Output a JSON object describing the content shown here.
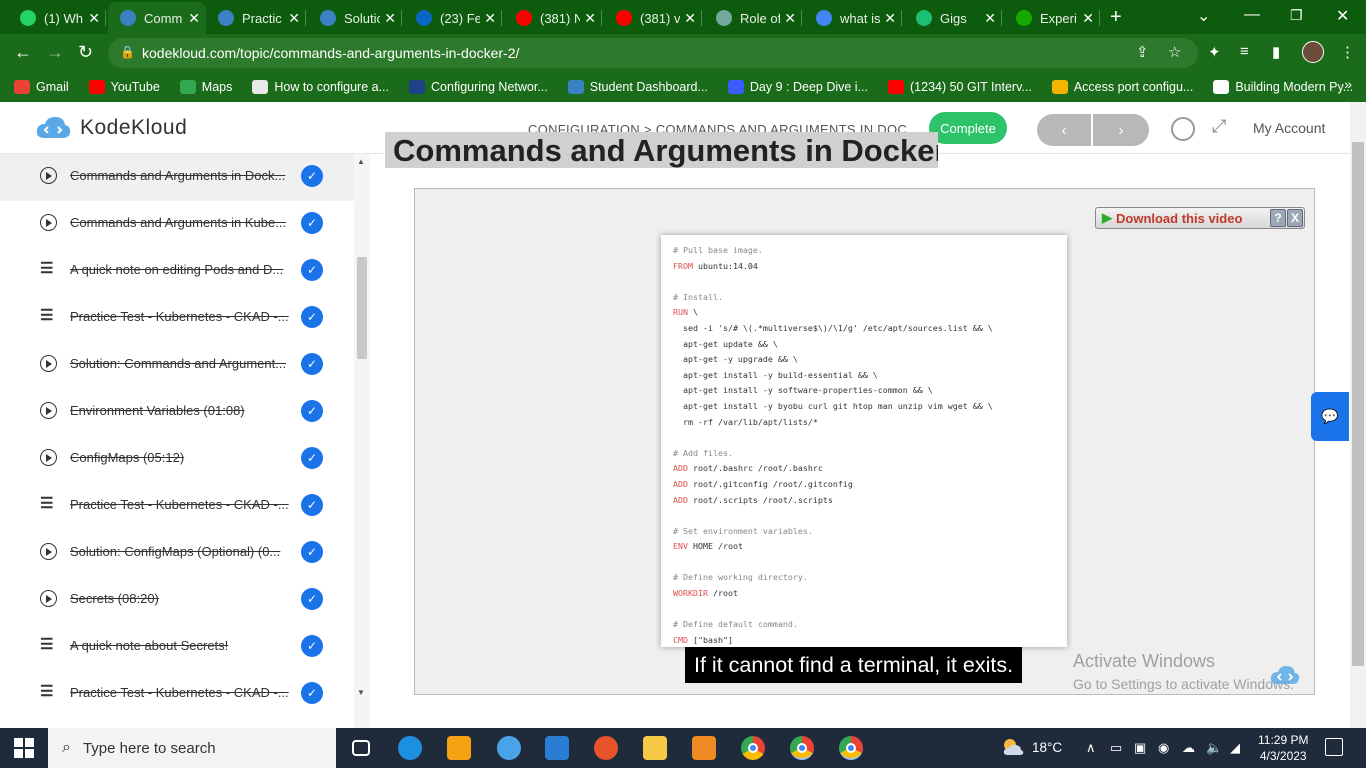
{
  "browser": {
    "tabs": [
      {
        "title": "(1) Wh",
        "icon": "whatsapp",
        "color": "#25d366",
        "active": false
      },
      {
        "title": "Comm",
        "icon": "kodekloud",
        "color": "#3b82c4",
        "active": true
      },
      {
        "title": "Practic",
        "icon": "kodekloud",
        "color": "#3b82c4",
        "active": false
      },
      {
        "title": "Solutic",
        "icon": "kodekloud",
        "color": "#3b82c4",
        "active": false
      },
      {
        "title": "(23) Fe",
        "icon": "linkedin",
        "color": "#0a66c2",
        "active": false
      },
      {
        "title": "(381) N",
        "icon": "youtube",
        "color": "#ff0000",
        "active": false
      },
      {
        "title": "(381) v",
        "icon": "youtube",
        "color": "#ff0000",
        "active": false
      },
      {
        "title": "Role of",
        "icon": "openai",
        "color": "#74aa9c",
        "active": false
      },
      {
        "title": "what is",
        "icon": "google",
        "color": "#4285f4",
        "active": false
      },
      {
        "title": "Gigs",
        "icon": "fiverr",
        "color": "#1dbf73",
        "active": false
      },
      {
        "title": "Experi",
        "icon": "upwork",
        "color": "#14a800",
        "active": false
      }
    ],
    "url": "kodekloud.com/topic/commands-and-arguments-in-docker-2/",
    "bookmarks": [
      {
        "label": "Gmail",
        "icon": "gmail",
        "color": "#ea4335"
      },
      {
        "label": "YouTube",
        "icon": "youtube",
        "color": "#ff0000"
      },
      {
        "label": "Maps",
        "icon": "maps",
        "color": "#34a853"
      },
      {
        "label": "How to configure a...",
        "icon": "page",
        "color": "#e8e8e8"
      },
      {
        "label": "Configuring Networ...",
        "icon": "vmware",
        "color": "#1d428a"
      },
      {
        "label": "Student Dashboard...",
        "icon": "kodekloud",
        "color": "#3b82c4"
      },
      {
        "label": "Day 9 : Deep Dive i...",
        "icon": "diamond",
        "color": "#3b5bfd"
      },
      {
        "label": "(1234) 50 GIT Interv...",
        "icon": "youtube",
        "color": "#ff0000"
      },
      {
        "label": "Access port configu...",
        "icon": "network",
        "color": "#f4b400"
      },
      {
        "label": "Building Modern Py...",
        "icon": "coursera",
        "color": "#ffffff"
      }
    ]
  },
  "header": {
    "logo_text": "KodeKloud",
    "breadcrumb": "CONFIGURATION > COMMANDS AND ARGUMENTS IN DOC...",
    "complete_label": "Complete",
    "prev_label": "‹",
    "next_label": "›",
    "account_label": "My Account"
  },
  "sidebar": {
    "lessons": [
      {
        "title": "Commands and Arguments in Dock...",
        "type": "video",
        "done": true,
        "active": true
      },
      {
        "title": "Commands and Arguments in Kube...",
        "type": "video",
        "done": true,
        "active": false
      },
      {
        "title": "A quick note on editing Pods and D...",
        "type": "text",
        "done": true,
        "active": false
      },
      {
        "title": "Practice Test - Kubernetes - CKAD -...",
        "type": "text",
        "done": true,
        "active": false
      },
      {
        "title": "Solution: Commands and Argument...",
        "type": "video",
        "done": true,
        "active": false
      },
      {
        "title": "Environment Variables (01:08)",
        "type": "video",
        "done": true,
        "active": false
      },
      {
        "title": "ConfigMaps (05:12)",
        "type": "video",
        "done": true,
        "active": false
      },
      {
        "title": "Practice Test - Kubernetes - CKAD -...",
        "type": "text",
        "done": true,
        "active": false
      },
      {
        "title": "Solution: ConfigMaps (Optional) (0...",
        "type": "video",
        "done": true,
        "active": false
      },
      {
        "title": "Secrets (08:20)",
        "type": "video",
        "done": true,
        "active": false
      },
      {
        "title": "A quick note about Secrets!",
        "type": "text",
        "done": true,
        "active": false
      },
      {
        "title": "Practice Test - Kubernetes - CKAD -...",
        "type": "text",
        "done": true,
        "active": false
      }
    ]
  },
  "main": {
    "page_title": "Commands and Arguments in Docker",
    "download_label": "Download this video",
    "help_label": "?",
    "close_label": "X",
    "code_lines": [
      {
        "text": "# Pull base image.",
        "kind": "comment"
      },
      {
        "kw": "FROM",
        "text": " ubuntu:14.04"
      },
      {
        "text": "",
        "kind": "blank"
      },
      {
        "text": "# Install.",
        "kind": "comment"
      },
      {
        "kw": "RUN",
        "text": " \\"
      },
      {
        "text": "  sed -i 's/# \\(.*multiverse$\\)/\\1/g' /etc/apt/sources.list && \\"
      },
      {
        "text": "  apt-get update && \\"
      },
      {
        "text": "  apt-get -y upgrade && \\"
      },
      {
        "text": "  apt-get install -y build-essential && \\"
      },
      {
        "text": "  apt-get install -y software-properties-common && \\"
      },
      {
        "text": "  apt-get install -y byobu curl git htop man unzip vim wget && \\"
      },
      {
        "text": "  rm -rf /var/lib/apt/lists/*"
      },
      {
        "text": "",
        "kind": "blank"
      },
      {
        "text": "# Add files.",
        "kind": "comment"
      },
      {
        "kw": "ADD",
        "text": " root/.bashrc /root/.bashrc"
      },
      {
        "kw": "ADD",
        "text": " root/.gitconfig /root/.gitconfig"
      },
      {
        "kw": "ADD",
        "text": " root/.scripts /root/.scripts"
      },
      {
        "text": "",
        "kind": "blank"
      },
      {
        "text": "# Set environment variables.",
        "kind": "comment"
      },
      {
        "kw": "ENV",
        "text": " HOME /root"
      },
      {
        "text": "",
        "kind": "blank"
      },
      {
        "text": "# Define working directory.",
        "kind": "comment"
      },
      {
        "kw": "WORKDIR",
        "text": " /root"
      },
      {
        "text": "",
        "kind": "blank"
      },
      {
        "text": "# Define default command.",
        "kind": "comment"
      },
      {
        "kw": "CMD",
        "text": " [\"bash\"]"
      }
    ],
    "caption": "If it cannot find a terminal, it exits.",
    "watermark_line1": "Activate Windows",
    "watermark_line2": "Go to Settings to activate Windows."
  },
  "taskbar": {
    "search_placeholder": "Type here to search",
    "temperature": "18°C",
    "time": "11:29 PM",
    "date": "4/3/2023",
    "apps": [
      {
        "name": "task-view",
        "color": "#ffffff"
      },
      {
        "name": "edge",
        "color": "#1d8fe0"
      },
      {
        "name": "store",
        "color": "#f3a312"
      },
      {
        "name": "skype-like",
        "color": "#4aa3e8"
      },
      {
        "name": "mail",
        "color": "#2b7cd3"
      },
      {
        "name": "brave-like",
        "color": "#e8542a"
      },
      {
        "name": "file-explorer",
        "color": "#f7c948"
      },
      {
        "name": "settings-orange",
        "color": "#f08a24"
      },
      {
        "name": "chrome",
        "color": "#34a853"
      },
      {
        "name": "chrome-profile-1",
        "color": "#34a853"
      },
      {
        "name": "chrome-profile-2",
        "color": "#ea4335"
      }
    ]
  }
}
